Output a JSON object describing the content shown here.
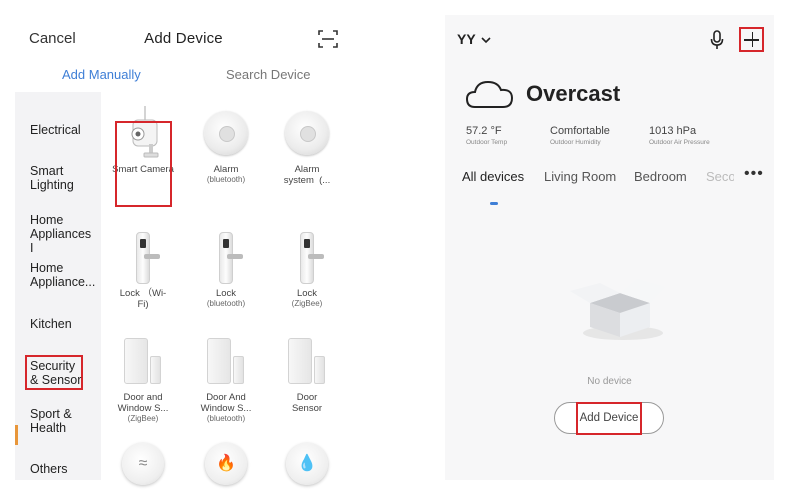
{
  "add_device_screen": {
    "cancel_label": "Cancel",
    "title": "Add Device",
    "scan_icon": "scan-icon",
    "tabs": [
      {
        "label": "Add Manually",
        "active": true
      },
      {
        "label": "Search Device",
        "active": false
      }
    ],
    "categories": [
      {
        "label": "Electrical"
      },
      {
        "label": "Smart Lighting"
      },
      {
        "label": "Home Appliances I"
      },
      {
        "label": "Home Appliance..."
      },
      {
        "label": "Kitchen"
      },
      {
        "label": "Security & Sensor",
        "active": true
      },
      {
        "label": "Sport & Health"
      },
      {
        "label": "Others"
      }
    ],
    "devices": [
      {
        "name": "Smart Camera",
        "sub": "",
        "icon": "camera-icon"
      },
      {
        "name": "Alarm",
        "sub": "(bluetooth)",
        "icon": "alarm-icon"
      },
      {
        "name": "Alarm system  (...",
        "sub": "",
        "icon": "alarm-icon"
      },
      {
        "name": "Lock （Wi-Fi)",
        "sub": "",
        "icon": "lock-icon"
      },
      {
        "name": "Lock",
        "sub": "(bluetooth)",
        "icon": "lock-icon"
      },
      {
        "name": "Lock",
        "sub": "(ZigBee)",
        "icon": "lock-icon"
      },
      {
        "name": "Door and Window S...",
        "sub": "(ZigBee)",
        "icon": "door-sensor-icon"
      },
      {
        "name": "Door And Window S...",
        "sub": "(bluetooth)",
        "icon": "door-sensor-icon"
      },
      {
        "name": "Door Sensor",
        "sub": "",
        "icon": "door-sensor-icon"
      },
      {
        "name": "",
        "sub": "",
        "icon": "gas-sensor-icon"
      },
      {
        "name": "",
        "sub": "",
        "icon": "smoke-sensor-icon"
      },
      {
        "name": "",
        "sub": "",
        "icon": "water-sensor-icon"
      }
    ],
    "accent_color": "#3f7fd6",
    "highlight_color": "#d6262b",
    "active_indicator_color": "#e8963a"
  },
  "home_screen": {
    "home_name": "YY",
    "weather": {
      "condition": "Overcast",
      "temp_value": "57.2 °F",
      "temp_label": "Outdoor Temp",
      "humidity_value": "Comfortable",
      "humidity_label": "Outdoor Humidity",
      "pressure_value": "1013 hPa",
      "pressure_label": "Outdoor Air Pressure"
    },
    "room_tabs": [
      {
        "label": "All devices",
        "active": true
      },
      {
        "label": "Living Room",
        "active": false
      },
      {
        "label": "Bedroom",
        "active": false
      },
      {
        "label": "Seco",
        "active": false
      }
    ],
    "more_label": "•••",
    "empty_text": "No device",
    "add_device_label": "Add Device"
  }
}
